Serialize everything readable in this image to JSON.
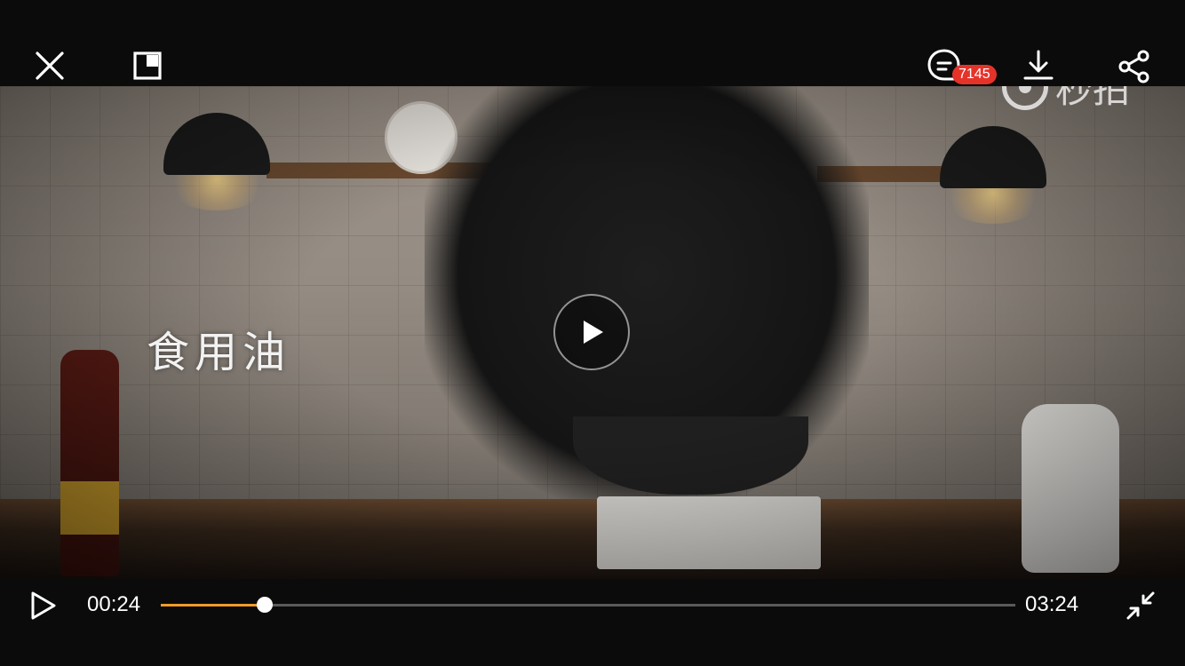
{
  "top_bar": {
    "close_icon": "close-icon",
    "pip_icon": "picture-in-picture-icon",
    "comment_icon": "comment-icon",
    "comment_count": "7145",
    "download_icon": "download-icon",
    "share_icon": "share-icon"
  },
  "video": {
    "caption": "食用油",
    "watermark_text": "秒拍",
    "play_icon": "play-icon"
  },
  "controls": {
    "play_icon": "play-icon",
    "current_time": "00:24",
    "total_time": "03:24",
    "progress": 0.122,
    "exit_fullscreen_icon": "exit-fullscreen-icon",
    "accent_color": "#f19c2a"
  }
}
